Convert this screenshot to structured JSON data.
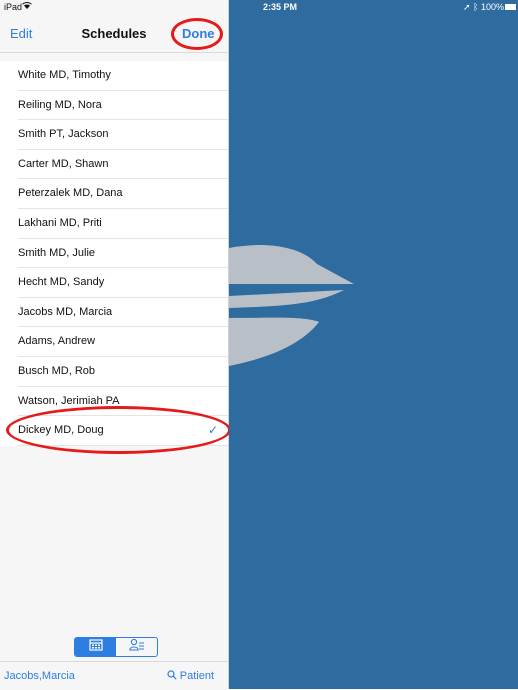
{
  "status_bar": {
    "carrier": "iPad",
    "time": "2:35 PM",
    "battery": "100%"
  },
  "navbar": {
    "edit_label": "Edit",
    "title": "Schedules",
    "done_label": "Done"
  },
  "schedules": [
    {
      "name": "White MD, Timothy",
      "selected": false
    },
    {
      "name": "Reiling MD, Nora",
      "selected": false
    },
    {
      "name": "Smith PT, Jackson",
      "selected": false
    },
    {
      "name": "Carter MD, Shawn",
      "selected": false
    },
    {
      "name": "Peterzalek MD, Dana",
      "selected": false
    },
    {
      "name": "Lakhani MD, Priti",
      "selected": false
    },
    {
      "name": "Smith MD, Julie",
      "selected": false
    },
    {
      "name": "Hecht MD, Sandy",
      "selected": false
    },
    {
      "name": "Jacobs MD, Marcia",
      "selected": false
    },
    {
      "name": "Adams, Andrew",
      "selected": false
    },
    {
      "name": "Busch MD, Rob",
      "selected": false
    },
    {
      "name": "Watson, Jerimiah PA",
      "selected": false
    },
    {
      "name": "Dickey MD, Doug",
      "selected": true
    }
  ],
  "segmented_control": {
    "segments": [
      "calendar-icon",
      "person-list-icon"
    ],
    "active_index": 0
  },
  "bottom_bar": {
    "user_label": "Jacobs,Marcia",
    "patient_label": "Patient"
  },
  "colors": {
    "accent": "#2e7de1",
    "detail_background": "#2e6b9e",
    "annotation": "#e51a1a"
  }
}
